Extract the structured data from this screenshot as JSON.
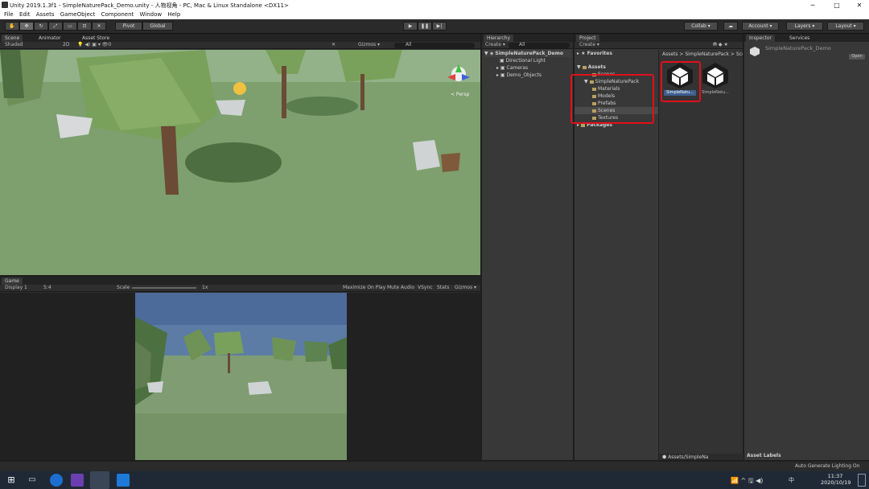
{
  "window": {
    "title": "Unity 2019.1.3f1 - SimpleNaturePack_Demo.unity - 人物视角 - PC, Mac & Linux Standalone <DX11>",
    "min": "─",
    "max": "□",
    "close": "✕"
  },
  "menu": [
    "File",
    "Edit",
    "Assets",
    "GameObject",
    "Component",
    "Window",
    "Help"
  ],
  "toolbar": {
    "pivot": "Pivot",
    "global": "Global",
    "collab": "Collab ▾",
    "account": "Account ▾",
    "layers": "Layers ▾",
    "layout": "Layout ▾"
  },
  "scene": {
    "tabs": [
      "Scene",
      "Animator",
      "Asset Store"
    ],
    "shading": "Shaded",
    "mode2d": "2D",
    "gizmos": "Gizmos ▾",
    "search": "All",
    "persp": "< Persp"
  },
  "game": {
    "tab": "Game",
    "display": "Display 1",
    "aspect": "5:4",
    "scale_label": "Scale",
    "scale_value": "1x",
    "maximize": "Maximize On Play",
    "mute": "Mute Audio",
    "vsync": "VSync",
    "stats": "Stats",
    "gizmos": "Gizmos ▾"
  },
  "hierarchy": {
    "tab": "Hierarchy",
    "create": "Create ▾",
    "search": "All",
    "scene": "SimpleNaturePack_Demo",
    "items": [
      "Directional Light",
      "Cameras",
      "Demo_Objects"
    ]
  },
  "project": {
    "tab": "Project",
    "create": "Create ▾",
    "favorites": "Favorites",
    "assets": "Assets",
    "tree": [
      "Scenes",
      "SimpleNaturePack",
      "Materials",
      "Models",
      "Prefabs",
      "Scenes",
      "Textures"
    ],
    "packages": "Packages",
    "breadcrumb": "Assets > SimpleNaturePack > Scenes",
    "files": [
      "SimpleNatu...",
      "SimpleNatu..."
    ],
    "footer_path": "Assets/SimpleNa"
  },
  "inspector": {
    "tabs": [
      "Inspector",
      "Services"
    ],
    "object": "SimpleNaturePack_Demo",
    "open": "Open",
    "labels": "Asset Labels"
  },
  "status": {
    "lighting": "Auto Generate Lighting On"
  },
  "taskbar": {
    "time": "11:37",
    "date": "2020/10/19",
    "ime": "中"
  }
}
